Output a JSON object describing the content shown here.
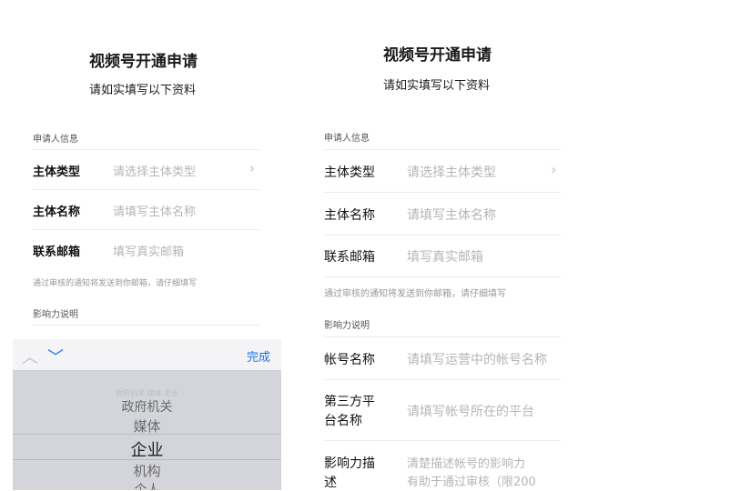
{
  "left": {
    "title": "视频号开通申请",
    "subtitle": "请如实填写以下资料",
    "section_applicant": "申请人信息",
    "rows": [
      {
        "label": "主体类型",
        "placeholder": "请选择主体类型"
      },
      {
        "label": "主体名称",
        "placeholder": "请填写主体名称"
      },
      {
        "label": "联系邮箱",
        "placeholder": "填写真实邮箱"
      }
    ],
    "note": "通过审核的通知将发送到你邮箱，请仔细填写",
    "section_influence": "影响力说明",
    "picker": {
      "done_label": "完成",
      "faded_top": "政府机关 媒体 企业",
      "options": [
        "政府机关",
        "媒体",
        "企业",
        "机构",
        "个人"
      ],
      "selected": "企业"
    }
  },
  "right": {
    "title": "视频号开通申请",
    "subtitle": "请如实填写以下资料",
    "section_applicant": "申请人信息",
    "rows": [
      {
        "label": "主体类型",
        "placeholder": "请选择主体类型"
      },
      {
        "label": "主体名称",
        "placeholder": "请填写主体名称"
      },
      {
        "label": "联系邮箱",
        "placeholder": "填写真实邮箱"
      }
    ],
    "note": "通过审核的通知将发送到你邮箱，请仔细填写",
    "section_influence": "影响力说明",
    "influence_rows": [
      {
        "label": "帐号名称",
        "placeholder": "请填写运营中的帐号名称"
      },
      {
        "label_line1": "第三方平",
        "label_line2": "台名称",
        "placeholder": "请填写帐号所在的平台"
      },
      {
        "label_line1": "影响力描",
        "label_line2": "述",
        "placeholder_line1": "清楚描述帐号的影响力",
        "placeholder_line2": "有助于通过审核（限200"
      }
    ]
  },
  "icons": {
    "chevron_right": "chevron-right-icon",
    "up": "chevron-up-icon",
    "down": "chevron-down-icon"
  },
  "colors": {
    "accent": "#1a73e8",
    "placeholder": "#b5b5b5",
    "picker_bg": "#d3d5db"
  }
}
